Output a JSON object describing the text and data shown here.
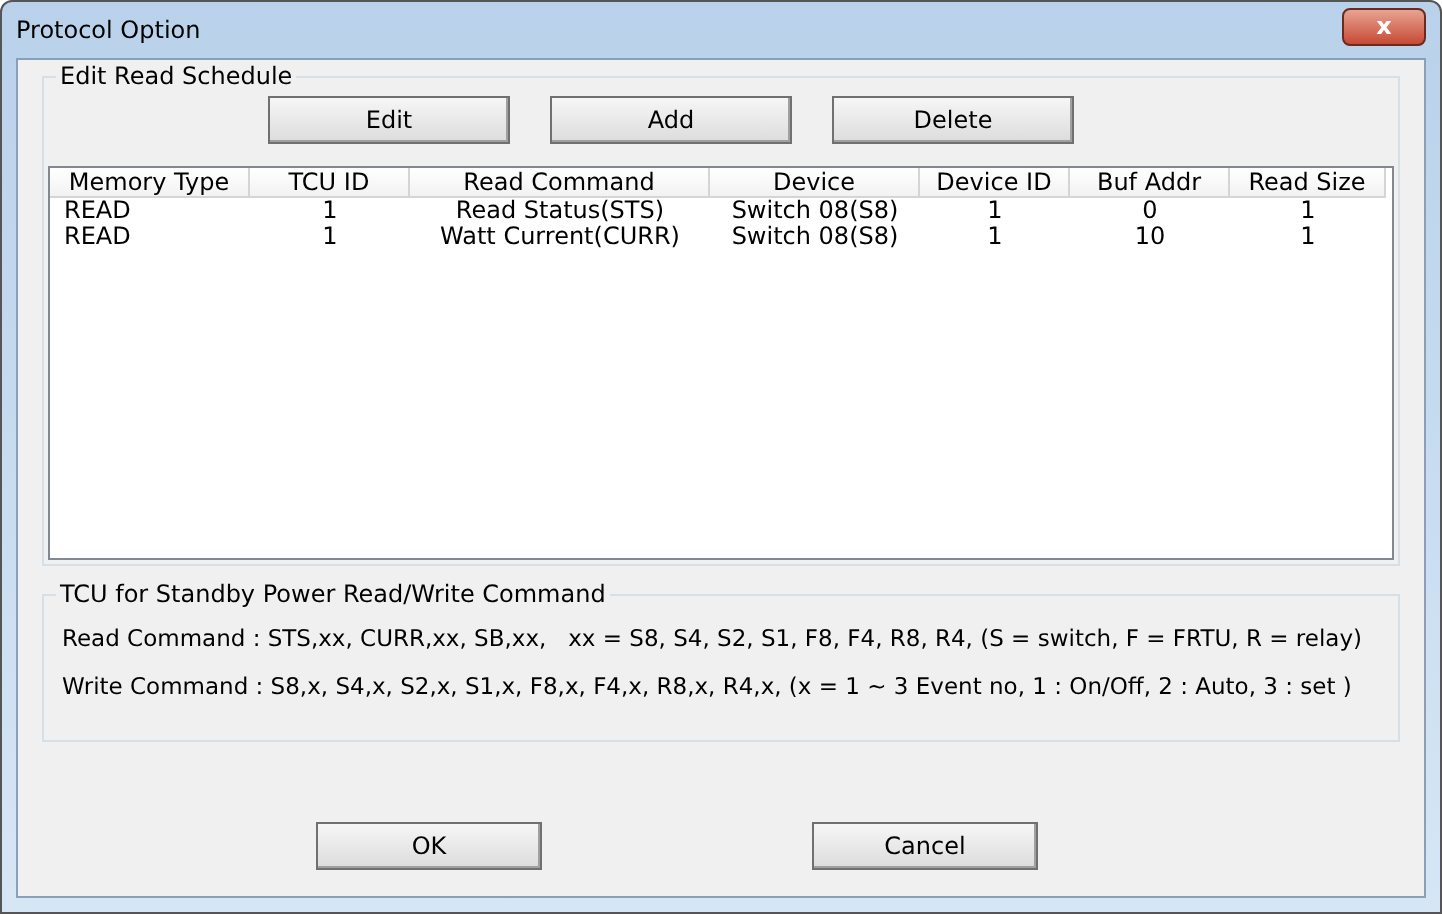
{
  "window": {
    "title": "Protocol Option",
    "close": "x"
  },
  "schedule": {
    "title": "Edit Read Schedule",
    "buttons": [
      "Edit",
      "Add",
      "Delete"
    ],
    "columns": [
      "Memory Type",
      "TCU ID",
      "Read Command",
      "Device",
      "Device ID",
      "Buf Addr",
      "Read Size"
    ],
    "rows": [
      [
        "READ",
        "1",
        "Read Status(STS)",
        "Switch 08(S8)",
        "1",
        "0",
        "1"
      ],
      [
        "READ",
        "1",
        "Watt Current(CURR)",
        "Switch 08(S8)",
        "1",
        "10",
        "1"
      ]
    ]
  },
  "standby": {
    "title": "TCU for Standby Power Read/Write Command",
    "lines": [
      "Read Command : STS,xx, CURR,xx, SB,xx,   xx = S8, S4, S2, S1, F8, F4, R8, R4, (S = switch, F = FRTU, R = relay)",
      "Write Command : S8,x, S4,x, S2,x, S1,x, F8,x, F4,x, R8,x, R4,x, (x = 1 ~ 3 Event no, 1 : On/Off, 2 : Auto, 3 : set )"
    ]
  },
  "buttons": [
    "OK",
    "Cancel"
  ]
}
